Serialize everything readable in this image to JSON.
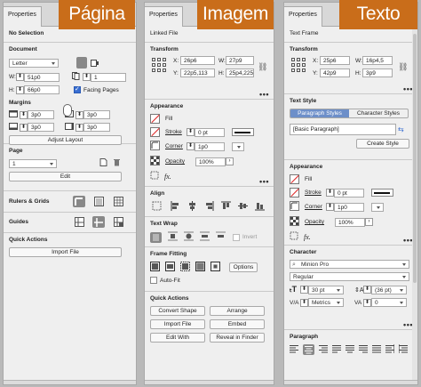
{
  "overlays": {
    "pagina": "Página",
    "imagem": "Imagem",
    "texto": "Texto"
  },
  "p1": {
    "tab": "Properties",
    "selection": "No Selection",
    "document": {
      "heading": "Document",
      "page_size": "Letter",
      "w_label": "W:",
      "w_value": "51p0",
      "h_label": "H:",
      "h_value": "66p0",
      "pages_value": "1",
      "facing_pages": "Facing Pages"
    },
    "margins": {
      "heading": "Margins",
      "top": "3p0",
      "bottom": "3p0",
      "left": "3p0",
      "right": "3p0",
      "adjust_button": "Adjust Layout"
    },
    "page": {
      "heading": "Page",
      "page_value": "1",
      "edit_button": "Edit"
    },
    "rulers": {
      "heading": "Rulers & Grids"
    },
    "guides": {
      "heading": "Guides"
    },
    "quick_actions": {
      "heading": "Quick Actions",
      "import_button": "Import File"
    }
  },
  "p2": {
    "tab": "Properties",
    "selection": "Linked File",
    "transform": {
      "heading": "Transform",
      "x_label": "X:",
      "x_value": "26p6",
      "y_label": "Y:",
      "y_value": "22p5,113",
      "w_label": "W:",
      "w_value": "27p9",
      "h_label": "H:",
      "h_value": "25p4,225"
    },
    "appearance": {
      "heading": "Appearance",
      "fill": "Fill",
      "stroke": "Stroke",
      "stroke_value": "0 pt",
      "corner": "Corner",
      "corner_value": "1p0",
      "opacity": "Opacity",
      "opacity_value": "100%",
      "fx": "fx."
    },
    "align": {
      "heading": "Align"
    },
    "text_wrap": {
      "heading": "Text Wrap",
      "invert": "Invert"
    },
    "frame_fitting": {
      "heading": "Frame Fitting",
      "options_button": "Options",
      "auto_fit": "Auto-Fit"
    },
    "quick_actions": {
      "heading": "Quick Actions",
      "convert_shape": "Convert Shape",
      "arrange": "Arrange",
      "import_file": "Import File",
      "embed": "Embed",
      "edit_with": "Edit With",
      "reveal": "Reveal in Finder"
    }
  },
  "p3": {
    "tab": "Properties",
    "selection": "Text Frame",
    "transform": {
      "heading": "Transform",
      "x_label": "X:",
      "x_value": "25p6",
      "y_label": "Y:",
      "y_value": "42p9",
      "w_label": "W:",
      "w_value": "16p4,5",
      "h_label": "H:",
      "h_value": "3p9"
    },
    "text_style": {
      "heading": "Text Style",
      "tab_paragraph": "Paragraph Styles",
      "tab_character": "Character Styles",
      "style_value": "[Basic Paragraph]",
      "create_button": "Create Style"
    },
    "appearance": {
      "heading": "Appearance",
      "fill": "Fill",
      "stroke": "Stroke",
      "stroke_value": "0 pt",
      "corner": "Corner",
      "corner_value": "1p0",
      "opacity": "Opacity",
      "opacity_value": "100%",
      "fx": "fx."
    },
    "character": {
      "heading": "Character",
      "font": "Minion Pro",
      "weight": "Regular",
      "size": "30 pt",
      "leading": "(36 pt)",
      "kerning": "Metrics",
      "tracking": "0"
    },
    "paragraph": {
      "heading": "Paragraph"
    }
  }
}
